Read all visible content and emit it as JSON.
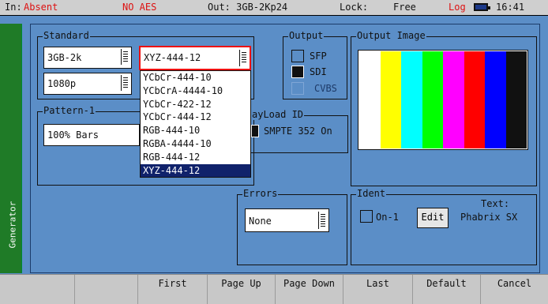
{
  "status": {
    "in_label": "In:",
    "in_value": "Absent",
    "aes": "NO AES",
    "out": "Out: 3GB-2Kp24",
    "lock_label": "Lock:",
    "lock_value": "Free",
    "log": "Log",
    "time": "16:41"
  },
  "side_tab": "Generator",
  "standard": {
    "title": "Standard",
    "format": "3GB-2k",
    "scan": "1080p",
    "colour_space": "XYZ-444-12",
    "options": [
      "YCbCr-444-10",
      "YCbCrA-4444-10",
      "YCbCr-422-12",
      "YCbCr-444-12",
      "RGB-444-10",
      "RGBA-4444-10",
      "RGB-444-12",
      "XYZ-444-12"
    ],
    "selected_option": "XYZ-444-12"
  },
  "output": {
    "title": "Output",
    "sfp": "SFP",
    "sdi": "SDI",
    "cvbs": "CVBS"
  },
  "output_image": {
    "title": "Output Image",
    "bar_colors": [
      "#ffffff",
      "#ffff00",
      "#00ffff",
      "#00ff00",
      "#ff00ff",
      "#ff0000",
      "#0000ff",
      "#111111"
    ]
  },
  "pattern": {
    "title": "Pattern-1",
    "value": "100% Bars"
  },
  "payload": {
    "title": "ayLoad ID",
    "value": "SMPTE 352 On"
  },
  "errors": {
    "title": "Errors",
    "value": "None"
  },
  "ident": {
    "title": "Ident",
    "on_label": "On-1",
    "edit": "Edit",
    "text_label": "Text:",
    "text_value": "Phabrix SX"
  },
  "softkeys": [
    "",
    "",
    "First",
    "Page Up",
    "Page Down",
    "Last",
    "Default",
    "Cancel"
  ],
  "colors": {
    "panel": "#5b8ec7",
    "side_tab": "#1f7b27",
    "selection": "#10226b",
    "highlight_border": "#e11"
  }
}
